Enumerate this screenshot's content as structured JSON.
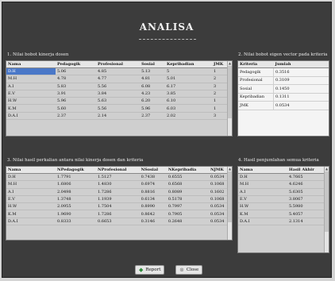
{
  "header": {
    "title": "ANALISA"
  },
  "section1": {
    "label": "1. Nilai bobot kinerja dosen",
    "columns": [
      "Nama",
      "Pedagogik",
      "Profesional",
      "Sosial",
      "Kepribadian",
      "JMK"
    ],
    "rows": [
      [
        "D.H",
        "5.06",
        "4.85",
        "5.13",
        "5",
        "1"
      ],
      [
        "M.H",
        "4.78",
        "4.77",
        "4.81",
        "5.01",
        "2"
      ],
      [
        "A.I",
        "5.83",
        "5.56",
        "6.08",
        "6.17",
        "3"
      ],
      [
        "E.V",
        "3.91",
        "3.84",
        "4.23",
        "3.85",
        "2"
      ],
      [
        "H.W",
        "5.96",
        "5.63",
        "6.20",
        "6.10",
        "1"
      ],
      [
        "K.M",
        "5.60",
        "5.56",
        "5.96",
        "6.03",
        "1"
      ],
      [
        "D.A.I",
        "2.37",
        "2.14",
        "2.37",
        "2.02",
        "3"
      ]
    ]
  },
  "section2": {
    "label": "2. Nilai bobot eigen vector pada kriteria",
    "columns": [
      "Kriteria",
      "Jumlah"
    ],
    "rows": [
      [
        "Pedagogik",
        "0.3516"
      ],
      [
        "Profesional",
        "0.3109"
      ],
      [
        "Sosial",
        "0.1450"
      ],
      [
        "Kepribadian",
        "0.1311"
      ],
      [
        "JMK",
        "0.0534"
      ]
    ]
  },
  "section3": {
    "label": "3. Nilai hasil perkalian antara nilai kinerja dosen dan kriteria",
    "columns": [
      "Nama",
      "NPedagogik",
      "NProfesional",
      "NSosial",
      "NKepribadia",
      "NJMK"
    ],
    "rows": [
      [
        "D.H",
        "1.7791",
        "1.5127",
        "0.7438",
        "0.6555",
        "0.0534"
      ],
      [
        "M.H",
        "1.6806",
        "1.4830",
        "0.6974",
        "0.6568",
        "0.1068"
      ],
      [
        "A.I",
        "2.0498",
        "1.7286",
        "0.8816",
        "0.8089",
        "0.1602"
      ],
      [
        "E.V",
        "1.3748",
        "1.1939",
        "0.6134",
        "0.5178",
        "0.1068"
      ],
      [
        "H.W",
        "2.0955",
        "1.7504",
        "0.8990",
        "0.7997",
        "0.0534"
      ],
      [
        "K.M",
        "1.9690",
        "1.7286",
        "0.8642",
        "0.7905",
        "0.0534"
      ],
      [
        "D.A.I",
        "0.8333",
        "0.6653",
        "0.3146",
        "0.2648",
        "0.0534"
      ]
    ]
  },
  "section4": {
    "label": "4. Hasil penjumlahan semua kriteria",
    "columns": [
      "Nama",
      "Hasil Akhir"
    ],
    "rows": [
      [
        "D.H",
        "4.7665"
      ],
      [
        "M.H",
        "4.6246"
      ],
      [
        "A.I",
        "5.6305"
      ],
      [
        "E.V",
        "3.8067"
      ],
      [
        "H.W",
        "5.5980"
      ],
      [
        "K.M",
        "5.4057"
      ],
      [
        "D.A.I",
        "2.1314"
      ]
    ]
  },
  "buttons": {
    "report": "Report",
    "close": "Close"
  },
  "icons": {
    "report": "report-icon",
    "close": "close-icon"
  }
}
